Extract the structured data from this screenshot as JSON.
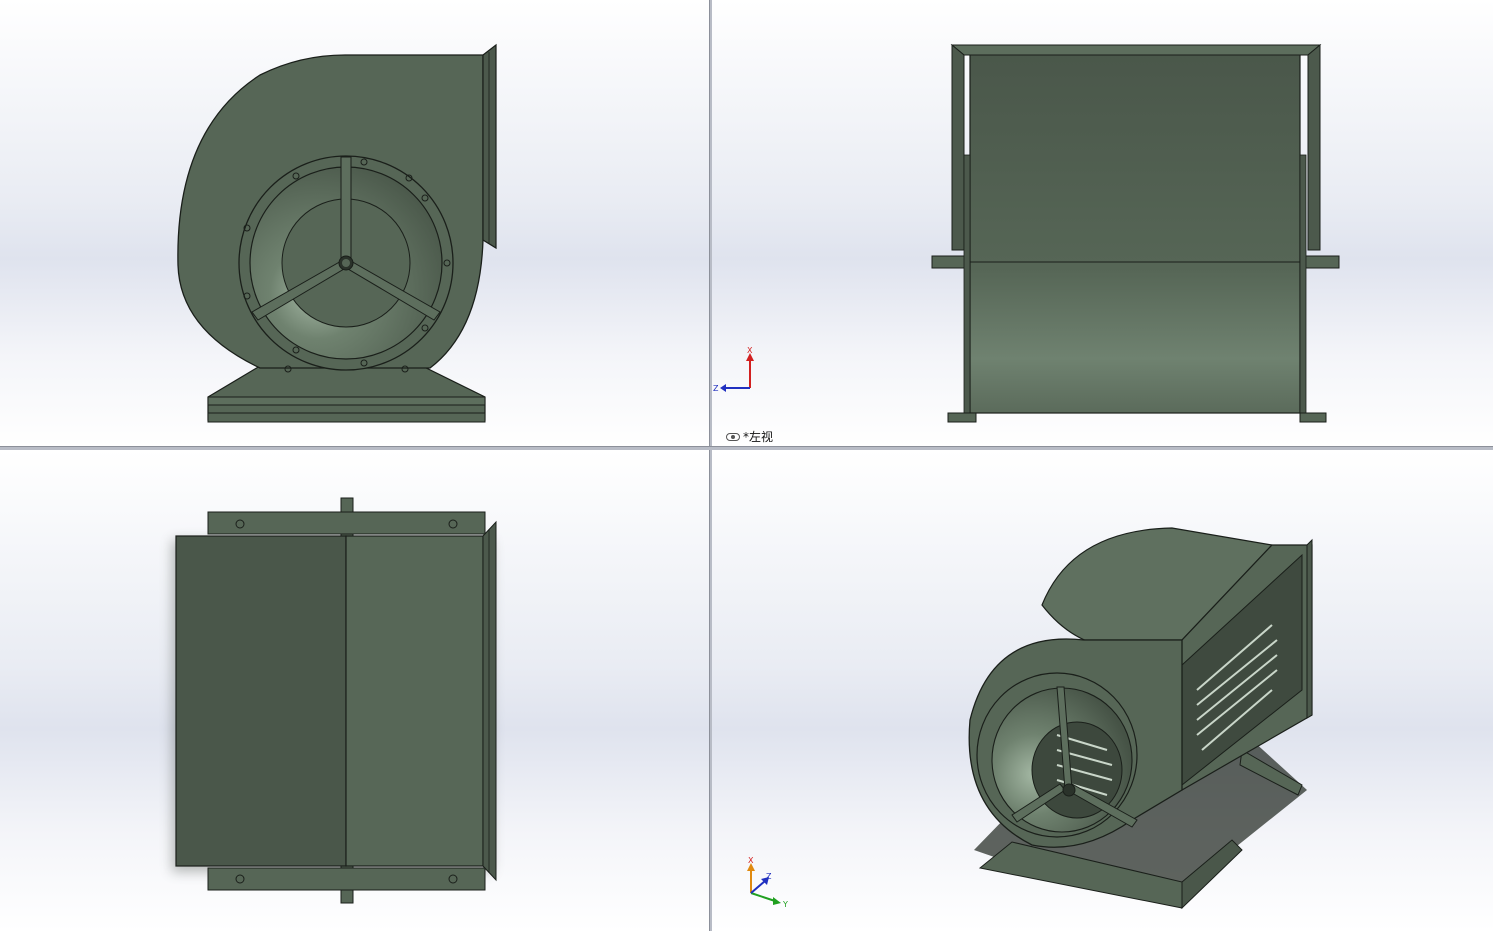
{
  "viewports": {
    "top_left": {
      "name": "front-view"
    },
    "top_right": {
      "name": "left-view",
      "label": "*左视",
      "triad": {
        "axis_up": "X",
        "axis_left": "Z"
      }
    },
    "bottom_left": {
      "name": "top-view"
    },
    "bottom_right": {
      "name": "isometric-view",
      "triad": {
        "axis_up": "X",
        "axis_mid": "Z",
        "axis_right": "Y"
      }
    }
  },
  "colors": {
    "body": "#566656",
    "body_dark": "#4a574a",
    "body_light": "#6f8270",
    "edge": "#1a1f1a",
    "axis_x": "#d22020",
    "axis_y": "#20a020",
    "axis_z": "#2030c0",
    "axis_orange": "#e08a10"
  }
}
